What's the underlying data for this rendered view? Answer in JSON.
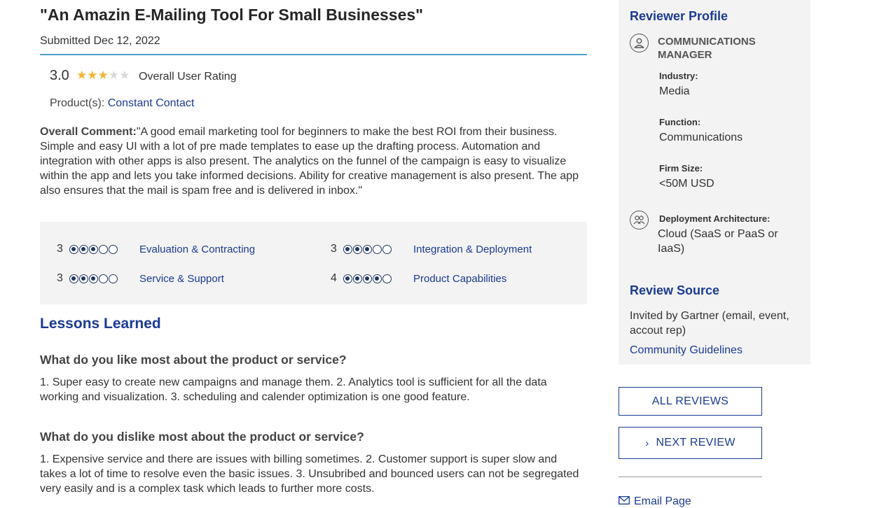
{
  "review": {
    "title": "\"An Amazin E-Mailing Tool For Small Businesses\"",
    "submitted": "Submitted Dec 12, 2022",
    "rating_value": "3.0",
    "rating_stars": 3,
    "rating_label": "Overall User Rating",
    "products_label": "Product(s):",
    "product_link": "Constant Contact",
    "comment_label": "Overall Comment:",
    "comment_text": "\"A good email marketing tool for beginners to make the best ROI from their business. Simple and easy UI with a lot of pre made templates to ease up the drafting process. Automation and integration with other apps is also present. The analytics on the funnel of the campaign is easy to visualize within the app and lets you take informed decisions. Ability for creative management is also present. The app also ensures that the mail is spam free and is delivered in inbox.\""
  },
  "scores": [
    {
      "value": "3",
      "filled": 3,
      "label": "Evaluation & Contracting"
    },
    {
      "value": "3",
      "filled": 3,
      "label": "Integration & Deployment"
    },
    {
      "value": "3",
      "filled": 3,
      "label": "Service & Support"
    },
    {
      "value": "4",
      "filled": 4,
      "label": "Product Capabilities"
    }
  ],
  "lessons": {
    "heading": "Lessons Learned",
    "q1": "What do you like most about the product or service?",
    "a1": "1. Super easy to create new campaigns and manage them. 2. Analytics tool is sufficient for all the data working and visualization. 3. scheduling and calender optimization is one good feature.",
    "q2": "What do you dislike most about the product or service?",
    "a2": "1. Expensive service and there are issues with billing sometimes. 2. Customer support is super slow and takes a lot of time to resolve even the basic issues. 3. Unsubribed and bounced users can not be segregated very easily and is a complex task which leads to further more costs."
  },
  "profile": {
    "heading": "Reviewer Profile",
    "role": "COMMUNICATIONS MANAGER",
    "industry_label": "Industry:",
    "industry": "Media",
    "function_label": "Function:",
    "function": "Communications",
    "firm_label": "Firm Size:",
    "firm": "<50M USD",
    "deploy_label": "Deployment Architecture:",
    "deploy": "Cloud (SaaS or PaaS or IaaS)"
  },
  "source": {
    "heading": "Review Source",
    "text": "Invited by Gartner (email, event, accout rep)",
    "link": "Community Guidelines"
  },
  "actions": {
    "all_reviews": "ALL REVIEWS",
    "next_review": "NEXT REVIEW",
    "email_page": "Email Page"
  },
  "colors": {
    "accent": "#1b3b93",
    "star": "#f2b531",
    "rule": "#4a9fc8",
    "panel": "#f3f3f3"
  }
}
